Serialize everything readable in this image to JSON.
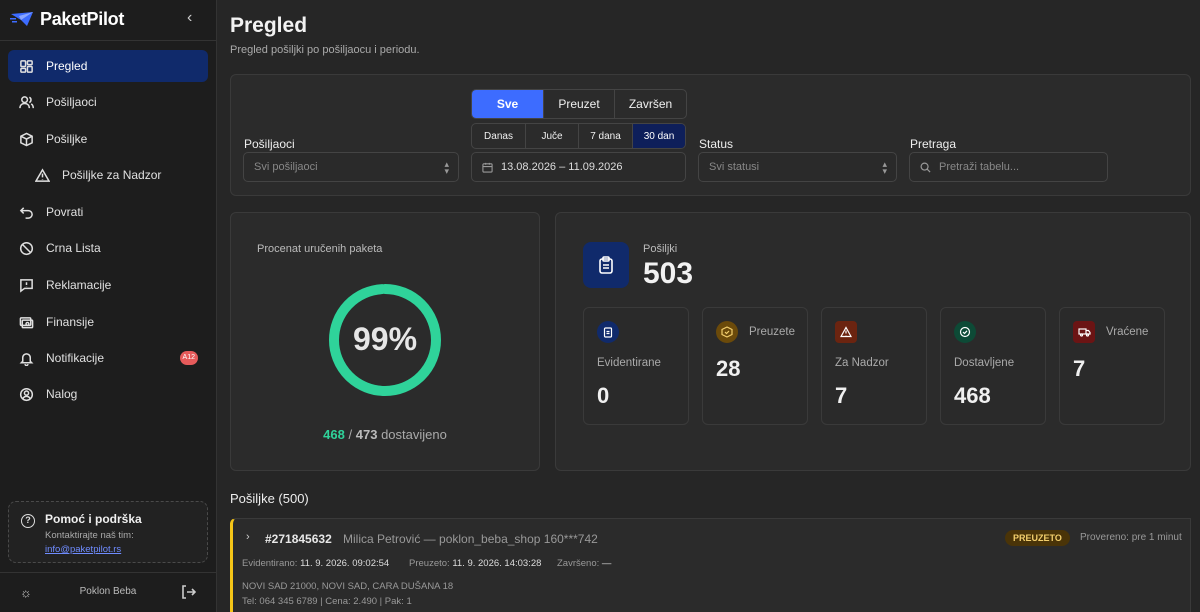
{
  "brand": {
    "name": "PaketPilot"
  },
  "sidebar": {
    "items": [
      {
        "label": "Pregled",
        "icon": "dashboard-icon"
      },
      {
        "label": "Pošiljaoci",
        "icon": "users-icon"
      },
      {
        "label": "Pošiljke",
        "icon": "box-icon"
      },
      {
        "label": "Pošiljke za Nadzor",
        "icon": "warning-icon"
      },
      {
        "label": "Povrati",
        "icon": "return-icon"
      },
      {
        "label": "Crna Lista",
        "icon": "ban-icon"
      },
      {
        "label": "Reklamacije",
        "icon": "message-alert-icon"
      },
      {
        "label": "Finansije",
        "icon": "finance-icon"
      },
      {
        "label": "Notifikacije",
        "icon": "bell-icon",
        "badge": "A12"
      },
      {
        "label": "Nalog",
        "icon": "account-icon"
      }
    ],
    "help": {
      "title": "Pomoć i podrška",
      "subtitle": "Kontaktirajte naš tim:",
      "email": "info@paketpilot.rs"
    },
    "footer": {
      "shop": "Poklon Beba"
    }
  },
  "header": {
    "title": "Pregled",
    "subtitle": "Pregled pošiljki po pošiljaocu i periodu."
  },
  "filters": {
    "status_tabs": [
      "Sve",
      "Preuzet",
      "Završen"
    ],
    "period_tabs": [
      "Danas",
      "Juče",
      "7 dana",
      "30 dan"
    ],
    "senders_label": "Pošiljaoci",
    "senders_placeholder": "Svi pošiljaoci",
    "date_range": "13.08.2026 – 11.09.2026",
    "status_label": "Status",
    "status_placeholder": "Svi statusi",
    "search_label": "Pretraga",
    "search_placeholder": "Pretraži tabelu..."
  },
  "delivery": {
    "label": "Procenat uručenih paketa",
    "percent_text": "99%",
    "percent": 0.99,
    "delivered": "468",
    "separator": "/",
    "total": "473",
    "suffix": "dostavijeno"
  },
  "shipments": {
    "label": "Pošiljki",
    "value": "503",
    "stats": [
      {
        "label": "Evidentirane",
        "value": "0",
        "color": "#102a6b",
        "icon": "clipboard-icon"
      },
      {
        "label": "Preuzete",
        "value": "28",
        "color": "#6b4a0a",
        "icon": "box-check-icon"
      },
      {
        "label": "Za Nadzor",
        "value": "7",
        "color": "#6b2410",
        "icon": "warning-icon"
      },
      {
        "label": "Dostavljene",
        "value": "468",
        "color": "#0d4a36",
        "icon": "check-circle-icon"
      },
      {
        "label": "Vraćene",
        "value": "7",
        "color": "#6b1414",
        "icon": "truck-icon"
      }
    ]
  },
  "list": {
    "title": "Pošiljke (500)",
    "rows": [
      {
        "id": "#271845632",
        "who": "Milica Petrović — poklon_beba_shop 160***742",
        "status": "PREUZETO",
        "checked": "Provereno: pre 1 minut",
        "registered_label": "Evidentirano:",
        "registered": "11. 9. 2026. 09:02:54",
        "picked_label": "Preuzeto:",
        "picked": "11. 9. 2026. 14:03:28",
        "done_label": "Završeno:",
        "done": "—",
        "address": "NOVI SAD 21000, NOVI SAD, CARA DUŠANA 18",
        "contact": "Tel: 064 345 6789 | Cena: 2.490 | Pak: 1"
      }
    ]
  }
}
